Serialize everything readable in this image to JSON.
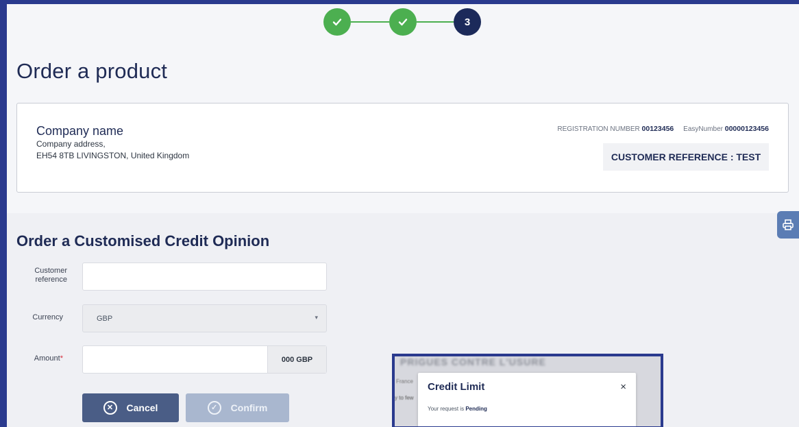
{
  "stepper": {
    "steps": [
      {
        "state": "done",
        "icon": "check-icon"
      },
      {
        "state": "done",
        "icon": "check-icon"
      },
      {
        "state": "current",
        "label": "3"
      }
    ],
    "colors": {
      "done": "#4caf50",
      "current": "#1c2a5a"
    }
  },
  "page": {
    "title": "Order a product"
  },
  "company": {
    "name": "Company name",
    "address_line1": "Company address,",
    "address_line2": "EH54 8TB LIVINGSTON, United Kingdom",
    "registration_label": "REGISTRATION NUMBER",
    "registration_number": "00123456",
    "easy_label": "EasyNumber",
    "easy_number": "00000123456",
    "customer_reference": "CUSTOMER REFERENCE : TEST"
  },
  "print_button": {
    "icon": "printer-icon"
  },
  "form": {
    "title": "Order a Customised Credit Opinion",
    "customer_reference_label": "Customer reference",
    "customer_reference_value": "",
    "currency_label": "Currency",
    "currency_value": "GBP",
    "amount_label": "Amount",
    "amount_required_mark": "*",
    "amount_value": "",
    "amount_suffix": "000 GBP",
    "cancel_label": "Cancel",
    "confirm_label": "Confirm"
  },
  "inset": {
    "background_heading": "PRIGUES CONTRE L'USURE",
    "side_text_1": "France",
    "side_text_2": "y to few",
    "modal": {
      "title": "Credit Limit",
      "close": "×",
      "message_prefix": "Your request is",
      "status": "Pending"
    }
  },
  "colors": {
    "frame_border": "#2a3a8e",
    "primary_text": "#1f2b55",
    "cancel_button": "#4a5d86",
    "confirm_button_disabled": "#a9b7cf",
    "required": "#d62d3a"
  }
}
